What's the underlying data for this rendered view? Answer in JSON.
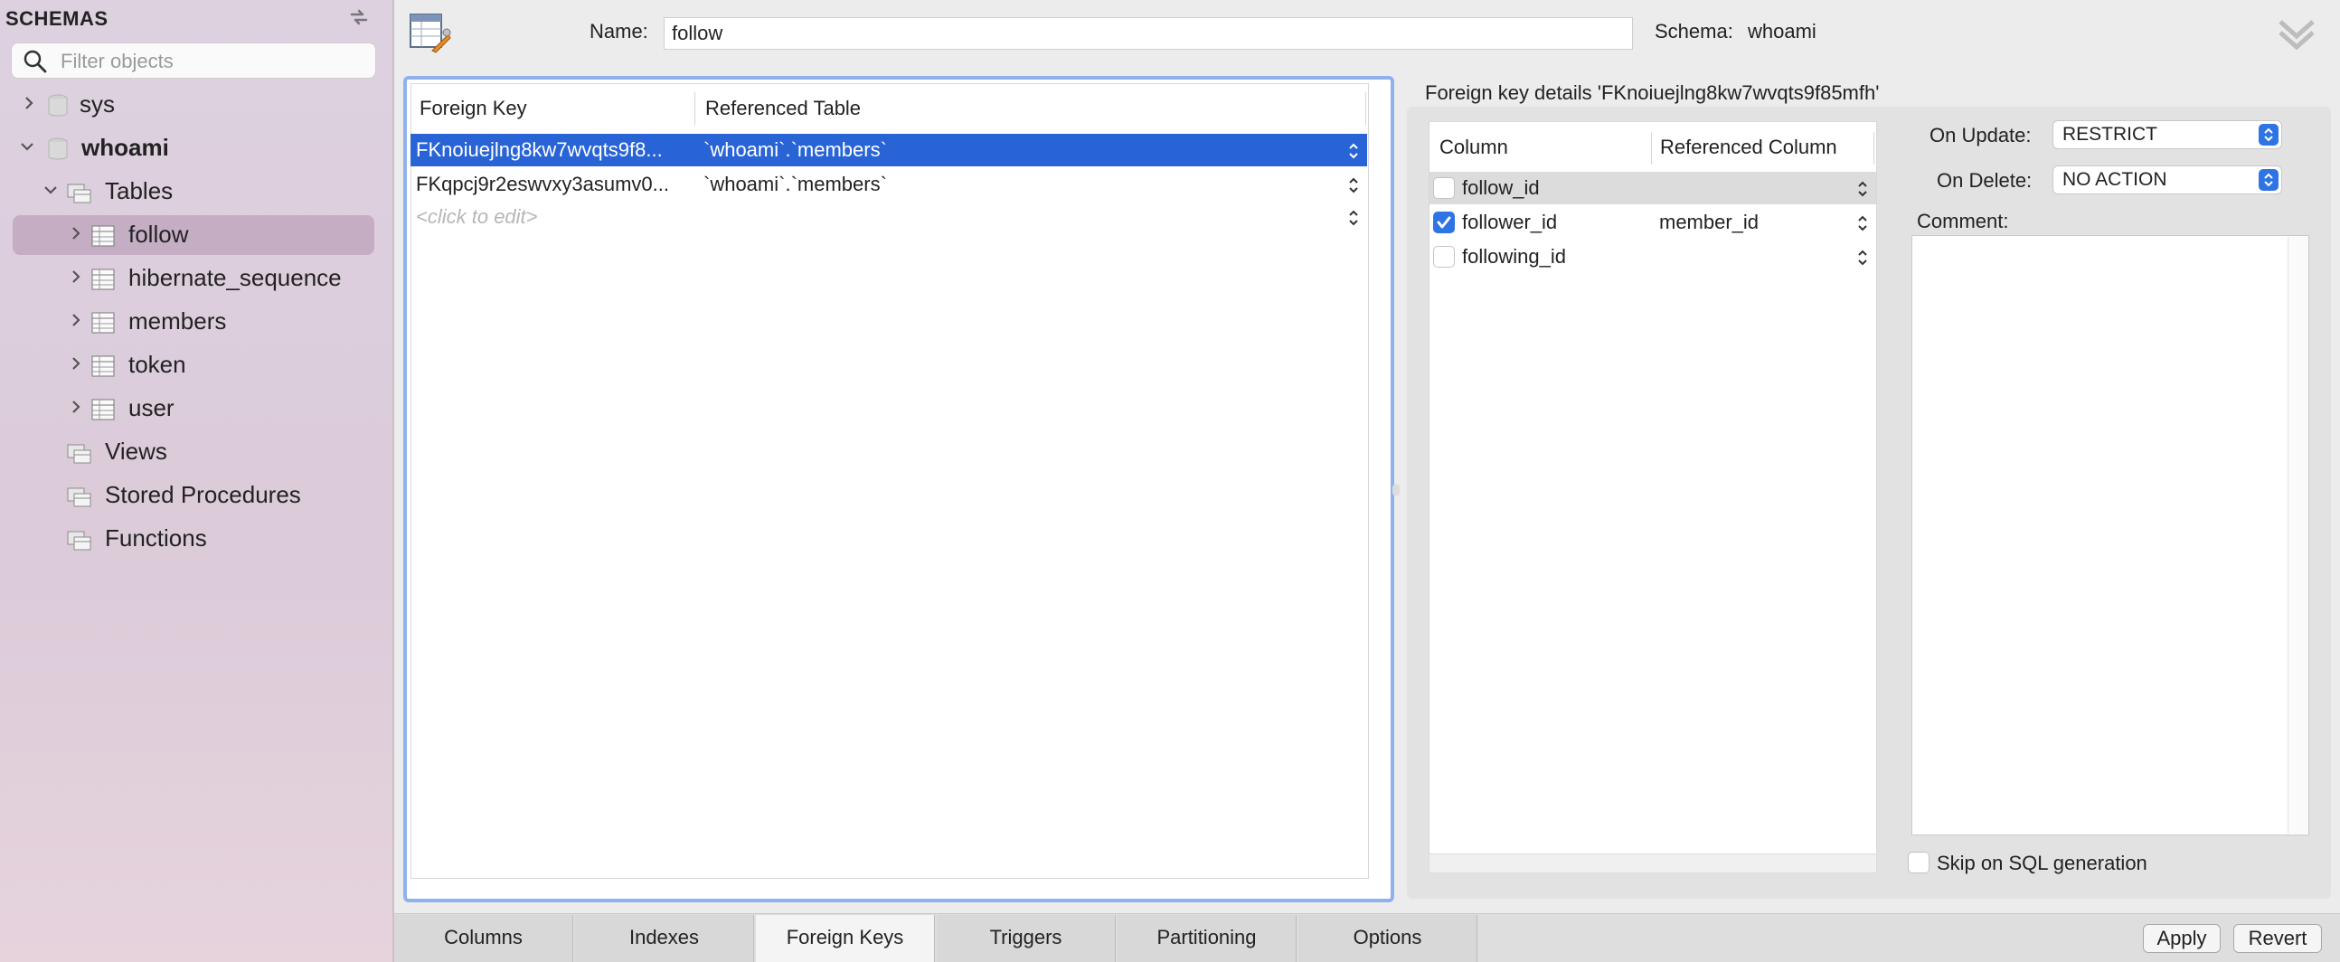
{
  "sidebar": {
    "title": "SCHEMAS",
    "filter_placeholder": "Filter objects",
    "tree": [
      {
        "label": "sys"
      },
      {
        "label": "whoami"
      },
      {
        "label": "Tables"
      },
      {
        "label": "follow"
      },
      {
        "label": "hibernate_sequence"
      },
      {
        "label": "members"
      },
      {
        "label": "token"
      },
      {
        "label": "user"
      },
      {
        "label": "Views"
      },
      {
        "label": "Stored Procedures"
      },
      {
        "label": "Functions"
      }
    ]
  },
  "editor": {
    "name_label": "Name:",
    "name_value": "follow",
    "schema_label": "Schema:",
    "schema_value": "whoami"
  },
  "fk_table": {
    "headers": [
      "Foreign Key",
      "Referenced Table"
    ],
    "rows": [
      {
        "fk": "FKnoiuejlng8kw7wvqts9f8...",
        "ref": "`whoami`.`members`"
      },
      {
        "fk": "FKqpcj9r2eswvxy3asumv0...",
        "ref": "`whoami`.`members`"
      },
      {
        "fk": "<click to edit>",
        "ref": ""
      }
    ]
  },
  "details": {
    "title": "Foreign key details 'FKnoiuejlng8kw7wvqts9f85mfh'",
    "headers": [
      "Column",
      "Referenced Column"
    ],
    "rows": [
      {
        "column": "follow_id",
        "ref": "",
        "checked": false
      },
      {
        "column": "follower_id",
        "ref": "member_id",
        "checked": true
      },
      {
        "column": "following_id",
        "ref": "",
        "checked": false
      }
    ],
    "on_update_label": "On Update:",
    "on_update_value": "RESTRICT",
    "on_delete_label": "On Delete:",
    "on_delete_value": "NO ACTION",
    "comment_label": "Comment:",
    "skip_label": "Skip on SQL generation"
  },
  "tabs": [
    "Columns",
    "Indexes",
    "Foreign Keys",
    "Triggers",
    "Partitioning",
    "Options"
  ],
  "active_tab": "Foreign Keys",
  "buttons": {
    "apply": "Apply",
    "revert": "Revert"
  },
  "colors": {
    "selection": "#2964d6",
    "checkbox_accent": "#2f74e4",
    "sidebar_selection": "#c5aec4",
    "focus_ring": "#8fb1ee"
  }
}
